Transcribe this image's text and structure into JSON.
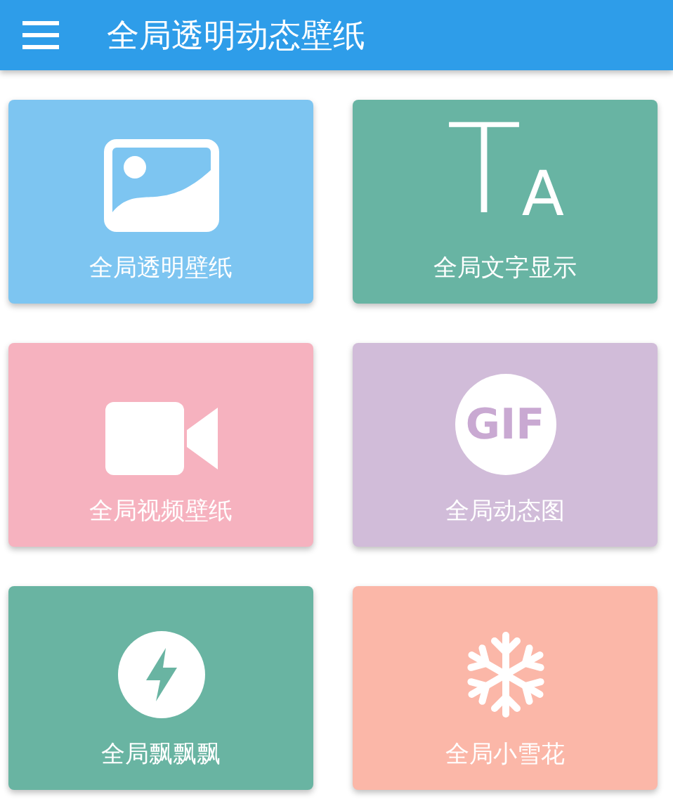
{
  "app_bar": {
    "title": "全局透明动态壁纸"
  },
  "rows": [
    {
      "cards": [
        {
          "kind": "image",
          "label": "全局透明壁纸",
          "color": "#7dc5f1"
        },
        {
          "kind": "text",
          "label": "全局文字显示",
          "color": "#68b4a3",
          "glyph": [
            "T",
            "A"
          ]
        }
      ]
    },
    {
      "cards": [
        {
          "kind": "video",
          "label": "全局视频壁纸",
          "color": "#f6b2bf"
        },
        {
          "kind": "gif",
          "label": "全局动态图",
          "color": "#d1bcd9",
          "badge": "GIF"
        }
      ]
    },
    {
      "cards": [
        {
          "kind": "bolt",
          "label": "全局飘飘飘",
          "color": "#69b4a2"
        },
        {
          "kind": "snow",
          "label": "全局小雪花",
          "color": "#fbb7a8"
        }
      ]
    }
  ]
}
